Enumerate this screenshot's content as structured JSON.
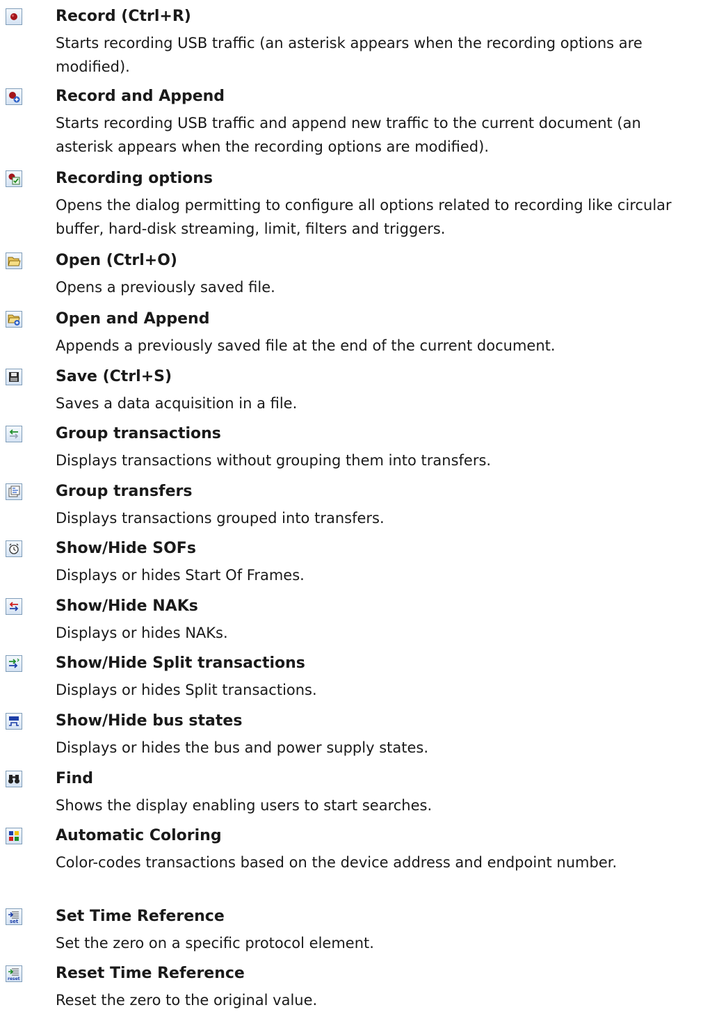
{
  "items": [
    {
      "icon": "record-icon",
      "title": "Record (Ctrl+R)",
      "desc": "Starts recording USB traffic (an asterisk appears when the recording options are modified)."
    },
    {
      "icon": "record-append-icon",
      "title": "Record and Append",
      "desc": "Starts recording USB traffic and append new traffic to the current document (an asterisk appears when the recording options are modified)."
    },
    {
      "icon": "recording-options-icon",
      "title": "Recording options",
      "desc": "Opens the dialog permitting to configure all options related to recording like circular buffer, hard-disk streaming, limit, filters and triggers."
    },
    {
      "icon": "open-folder-icon",
      "title": "Open (Ctrl+O)",
      "desc": "Opens a previously saved file."
    },
    {
      "icon": "open-append-icon",
      "title": "Open and Append",
      "desc": "Appends a previously saved file at the end of the current document."
    },
    {
      "icon": "save-disk-icon",
      "title": "Save (Ctrl+S)",
      "desc": "Saves a data acquisition in a file."
    },
    {
      "icon": "group-transactions-icon",
      "title": "Group transactions",
      "desc": "Displays transactions without grouping them into transfers."
    },
    {
      "icon": "group-transfers-icon",
      "title": "Group transfers",
      "desc": "Displays transactions grouped into transfers."
    },
    {
      "icon": "clock-icon",
      "title": "Show/Hide SOFs",
      "desc": "Displays or hides Start Of Frames."
    },
    {
      "icon": "naks-arrows-icon",
      "title": "Show/Hide NAKs",
      "desc": "Displays or hides NAKs."
    },
    {
      "icon": "split-transactions-icon",
      "title": "Show/Hide Split transactions",
      "desc": "Displays or hides Split transactions."
    },
    {
      "icon": "bus-states-icon",
      "title": "Show/Hide bus states",
      "desc": "Displays or hides the bus and power supply states."
    },
    {
      "icon": "binoculars-icon",
      "title": "Find",
      "desc": "Shows the display enabling users to start searches."
    },
    {
      "icon": "color-grid-icon",
      "title": "Automatic Coloring",
      "desc": "Color-codes transactions based on the device address and endpoint number."
    },
    {
      "icon": "set-time-reference-icon",
      "title": "Set Time Reference",
      "desc": "Set the zero on a specific protocol element."
    },
    {
      "icon": "reset-time-reference-icon",
      "title": "Reset Time Reference",
      "desc": "Reset the zero to the original value."
    }
  ]
}
